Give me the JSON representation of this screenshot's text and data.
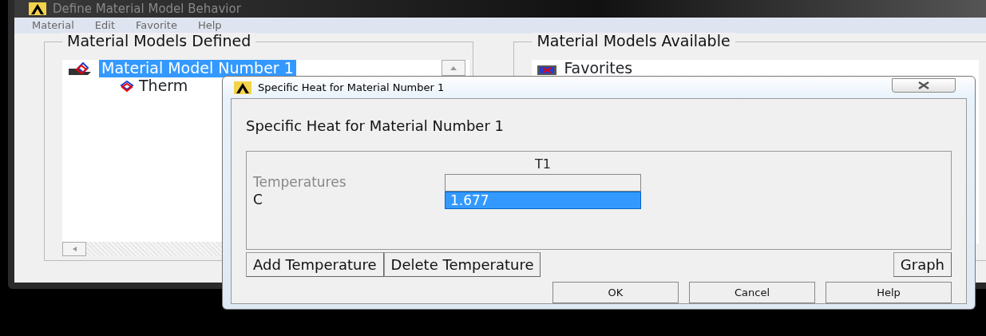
{
  "main_window": {
    "title": "Define Material Model Behavior",
    "menu": [
      "Material",
      "Edit",
      "Favorite",
      "Help"
    ],
    "defined_panel": {
      "title": "Material Models Defined",
      "tree": [
        {
          "label": "Material Model Number 1",
          "selected": true,
          "children": [
            {
              "label": "Therm",
              "selected": false
            }
          ]
        }
      ]
    },
    "available_panel": {
      "title": "Material Models Available",
      "tree": [
        {
          "label": "Favorites",
          "selected": false
        }
      ]
    }
  },
  "dialog": {
    "title": "Specific Heat for Material Number 1",
    "heading": "Specific Heat for Material Number 1",
    "table": {
      "column": "T1",
      "rows": [
        {
          "label": "Temperatures",
          "disabled": true,
          "selected": false
        },
        {
          "label": "C",
          "value": "1.677",
          "disabled": false,
          "selected": true
        }
      ]
    },
    "table_buttons": [
      "Add Temperature",
      "Delete Temperature"
    ],
    "graph_button": "Graph",
    "footer_buttons": [
      "OK",
      "Cancel",
      "Help"
    ]
  }
}
